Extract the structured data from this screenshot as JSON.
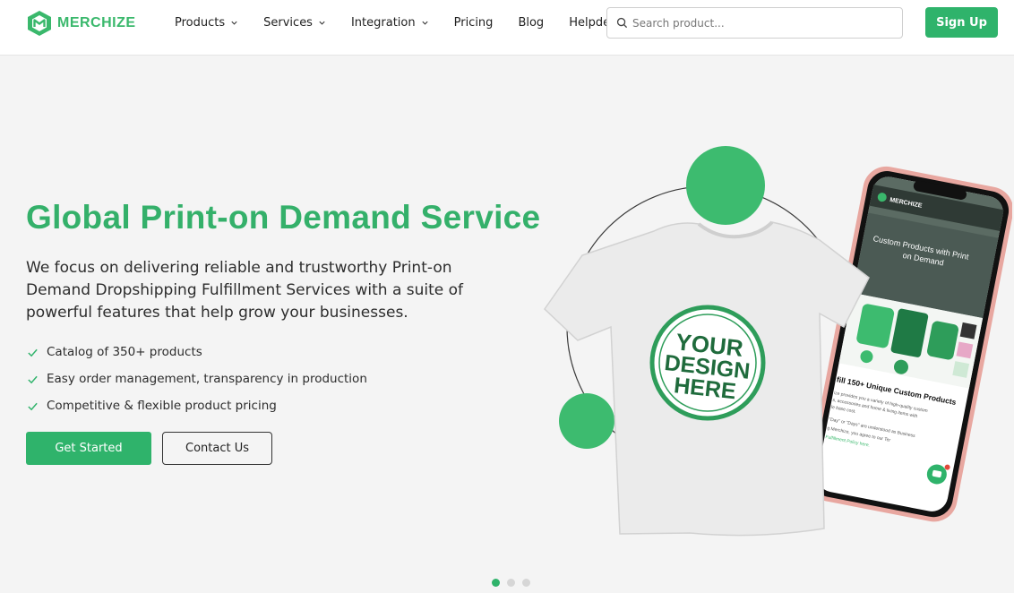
{
  "brand": {
    "name": "MERCHIZE",
    "color": "#2fb36b"
  },
  "nav": {
    "items": [
      {
        "label": "Products",
        "dropdown": true
      },
      {
        "label": "Services",
        "dropdown": true
      },
      {
        "label": "Integration",
        "dropdown": true
      },
      {
        "label": "Pricing",
        "dropdown": false
      },
      {
        "label": "Blog",
        "dropdown": false
      },
      {
        "label": "Helpdesk",
        "dropdown": false
      }
    ]
  },
  "search": {
    "placeholder": "Search product...",
    "icon": "search-icon"
  },
  "header": {
    "signup_label": "Sign Up"
  },
  "hero": {
    "title": "Global Print-on Demand Service",
    "description": "We focus on delivering reliable and trustworthy Print-on Demand Dropshipping Fulfillment Services with a suite of powerful features that help grow your businesses.",
    "features": [
      "Catalog of 350+ products",
      "Easy order management, transparency in production",
      "Competitive & flexible product pricing"
    ],
    "primary_cta": "Get Started",
    "secondary_cta": "Contact Us"
  },
  "illustration": {
    "tshirt_print": [
      "YOUR",
      "DESIGN",
      "HERE"
    ],
    "phone_brand": "MERCHIZE",
    "phone_banner": [
      "Custom Products with Print",
      "on Demand"
    ],
    "phone_heading": "fill 150+ Unique Custom Products",
    "phone_body": [
      "ize provides you a variety of high-quality custom",
      "s, accessories and home & living items with",
      "le base cost.",
      "\"Day\" or \"Days\" are understood as Business",
      "g Merchize, you agree to our Ter",
      "Fulfillment Policy here."
    ]
  },
  "slider": {
    "count": 3,
    "active_index": 0
  }
}
